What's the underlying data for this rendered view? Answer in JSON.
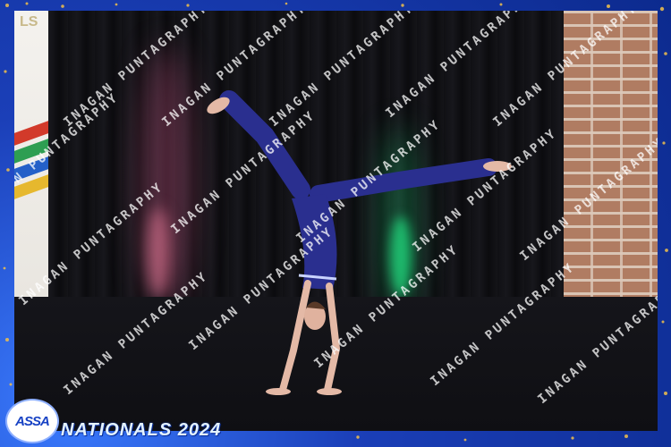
{
  "banner": {
    "text": "LS"
  },
  "watermark": {
    "text": "INAGAN PUNTAGRAPHY"
  },
  "logo": {
    "text": "ASSA"
  },
  "event": {
    "title": "NATIONALS 2024"
  },
  "colors": {
    "frame_blue": "#1b3fb8",
    "gold": "#f2c14b",
    "costume": "#2a2f8f",
    "curtain": "#101014",
    "floor": "#0f0f13",
    "green_light": "#1fd67a",
    "pink_light": "#d05a8a"
  }
}
